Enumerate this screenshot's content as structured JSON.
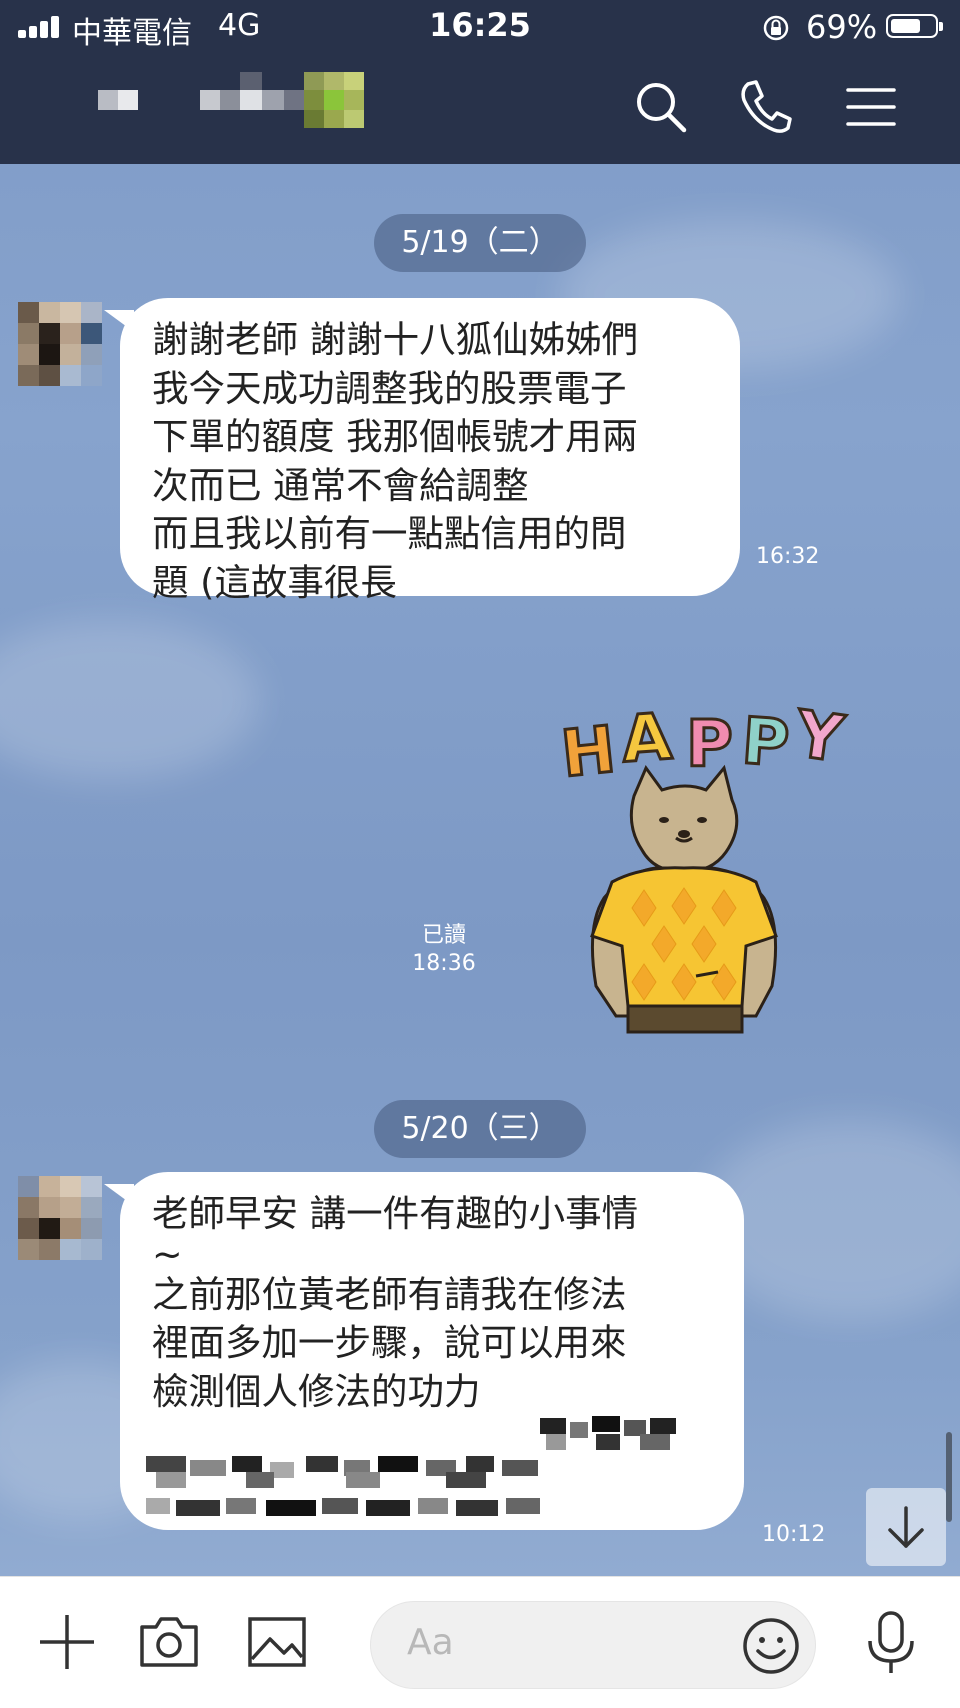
{
  "status_bar": {
    "carrier": "中華電信",
    "network": "4G",
    "time": "16:25",
    "battery_percent": "69%",
    "battery_level": 0.69
  },
  "header": {
    "title_redacted": true,
    "icons": [
      "search-icon",
      "phone-icon",
      "menu-icon"
    ]
  },
  "chat": {
    "date_1": "5/19（二）",
    "message_1": {
      "lines": [
        "謝謝老師 謝謝十八狐仙姊姊們",
        "我今天成功調整我的股票電子",
        "下單的額度 我那個帳號才用兩",
        "次而已 通常不會給調整",
        "而且我以前有一點點信用的問",
        "題 (這故事很長"
      ],
      "time": "16:32"
    },
    "sticker": {
      "text": "HAPPY",
      "letters": [
        "H",
        "A",
        "P",
        "P",
        "Y"
      ],
      "letter_colors": [
        "#f1a23a",
        "#f5c73f",
        "#f08cb0",
        "#8fd1c9",
        "#f2a7cc"
      ],
      "read_label": "已讀",
      "time": "18:36"
    },
    "date_2": "5/20（三）",
    "message_2": {
      "lines": [
        "老師早安 講一件有趣的小事情",
        "~",
        "之前那位黃老師有請我在修法",
        "裡面多加一步驟，說可以用來",
        "檢測個人修法的功力"
      ],
      "time": "10:12"
    }
  },
  "input_bar": {
    "placeholder": "Aa"
  },
  "colors": {
    "header_bg": "#28324a",
    "chat_bg": "#8aa5cd",
    "bubble": "#ffffff",
    "date_pill": "#566a8e"
  }
}
